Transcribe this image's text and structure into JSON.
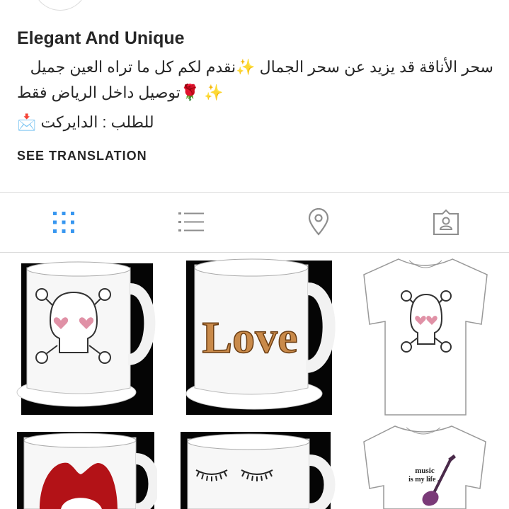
{
  "profile": {
    "name": "Elegant And Unique",
    "bio_line1": "سحر الأناقة قد يزيد عن سحر الجمال ✨نقدم لكم كل ما تراه العين جميل",
    "bio_line2": "✨ 🌹توصيل داخل الرياض فقط",
    "bio_line3": "للطلب : الدايركت 📩",
    "see_translation": "SEE TRANSLATION"
  },
  "tabs": [
    {
      "name": "grid-view",
      "icon": "grid-icon",
      "active": true,
      "color": "#3897f0"
    },
    {
      "name": "list-view",
      "icon": "list-icon",
      "active": false,
      "color": "#8e8e8e"
    },
    {
      "name": "location-view",
      "icon": "location-pin-icon",
      "active": false,
      "color": "#8e8e8e"
    },
    {
      "name": "tagged-view",
      "icon": "tagged-person-icon",
      "active": false,
      "color": "#8e8e8e"
    }
  ],
  "posts": [
    {
      "name": "skull-mug-post",
      "image": "white mug with skull and heart eyes"
    },
    {
      "name": "love-mug-post",
      "image": "white mug with gold LOVE letters",
      "text": "Love"
    },
    {
      "name": "skull-tshirt-post",
      "image": "white t-shirt with skull print"
    },
    {
      "name": "lips-mug-post",
      "image": "white mug with red lips"
    },
    {
      "name": "eyelashes-mug-post",
      "image": "white mug with closed eyes lashes"
    },
    {
      "name": "music-tshirt-post",
      "image": "white t-shirt with guitar",
      "text_line1": "music",
      "text_line2": "is my life .."
    }
  ]
}
